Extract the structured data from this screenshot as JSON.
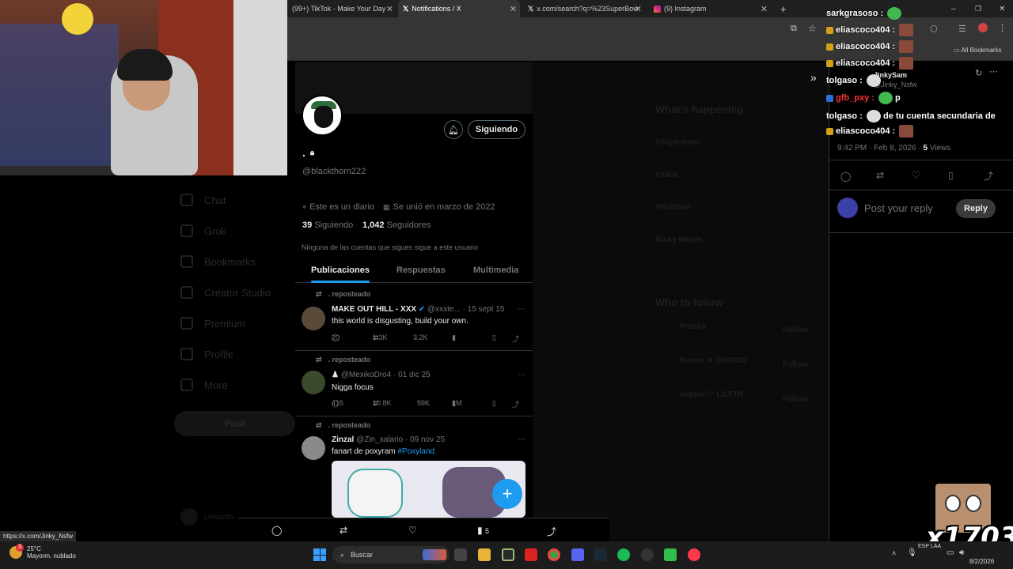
{
  "browser": {
    "tabs": [
      {
        "label": "(99+) TikTok - Make Your Day",
        "icon": "tiktok-icon"
      },
      {
        "label": "Notifications / X",
        "icon": "x-logo-icon"
      },
      {
        "label": "x.com/search?q=%23SuperBow",
        "icon": "x-logo-icon"
      },
      {
        "label": "(9) Instagram",
        "icon": "instagram-icon"
      }
    ],
    "all_bookmarks": "All Bookmarks",
    "status_url": "https://x.com/Jinky_Nsfw"
  },
  "left_nav": [
    "Chat",
    "Grok",
    "Bookmarks",
    "Creator Studio",
    "Premium",
    "Profile",
    "More"
  ],
  "left_nav_post": "Post",
  "left_nav_user": "Lehardfla",
  "profile": {
    "display_name": ".",
    "handle": "@blackthorn222",
    "follow_button": "Siguiendo",
    "bio": "Este es un diario",
    "joined": "Se unió en marzo de 2022",
    "following_count": "39",
    "following_label": "Siguiendo",
    "followers_count": "1,042",
    "followers_label": "Seguidores",
    "mutuals_note": "Ninguna de las cuentas que sigues sigue a este usuario",
    "tabs": [
      "Publicaciones",
      "Respuestas",
      "Multimedia"
    ]
  },
  "posts": [
    {
      "repost_label": ". reposteado",
      "name": "MAKE OUT HILL - XXX",
      "handle": "@xxxte...",
      "date": "· 15 sept 15",
      "text": "this world is disgusting, build your own.",
      "replies": "20",
      "reposts": "1.3K",
      "likes": "3.2K",
      "views": ""
    },
    {
      "repost_label": ". reposteado",
      "name": "♟",
      "handle": "@MexikoDro4",
      "date": "· 01 dic 25",
      "text": "Nigga focus",
      "replies": "415",
      "reposts": "10.8K",
      "likes": "59K",
      "views": "1M"
    },
    {
      "repost_label": ". reposteado",
      "name": "Zinzal",
      "handle": "@Zin_salario",
      "date": "· 09 nov 25",
      "text": "fanart de poxyram ",
      "hashtag": "#Poxyland"
    }
  ],
  "middle": {
    "whats_happening": "What's happening",
    "trends": [
      "#Superbowl",
      "#Xalia",
      "#Halftime",
      "Ricky Martin"
    ],
    "who_to_follow": "Who to follow",
    "suggestions": [
      "Prasha",
      "Kanna ✕ IGNCOU",
      "babyia ♡ LILYTH"
    ],
    "follow_label": "Follow"
  },
  "right_panel": {
    "timestamp": "9:42 PM · Feb 8, 2026 · ",
    "views_count": "5",
    "views_label": "Views",
    "reply_placeholder": "Post your reply",
    "reply_button": "Reply",
    "jinky_name": "JinkySam",
    "jinky_handle": "@Jinky_Nsfw"
  },
  "stream_chat": [
    {
      "user": "sarkgrasoso :",
      "msg": "",
      "color": "#ffffff"
    },
    {
      "user": "eliascoco404 :",
      "msg": "",
      "color": "#ffffff"
    },
    {
      "user": "eliascoco404 :",
      "msg": "",
      "color": "#ffffff"
    },
    {
      "user": "eliascoco404 :",
      "msg": "",
      "color": "#ffffff"
    },
    {
      "user": "tolgaso :",
      "msg": "",
      "color": "#ffffff"
    },
    {
      "user": "gfb_pxy :",
      "msg": "p",
      "color": "#ff3030"
    },
    {
      "user": "tolgaso :",
      "msg": "de tu cuenta secundaria de",
      "color": "#ffffff"
    },
    {
      "user": "eliascoco404 :",
      "msg": "",
      "color": "#ffffff"
    }
  ],
  "bottom_bar": {
    "views": "5"
  },
  "viewer_count": "x1703",
  "taskbar": {
    "weather_temp": "25°C",
    "weather_desc": "Mayorm. nublado",
    "weather_badge": "3",
    "search_label": "Buscar",
    "lang": "ESP LAA",
    "date": "8/2/2026"
  },
  "colors": {
    "accent": "#1d9bf0",
    "background": "#000000",
    "taskbar": "#1c1c1c"
  }
}
